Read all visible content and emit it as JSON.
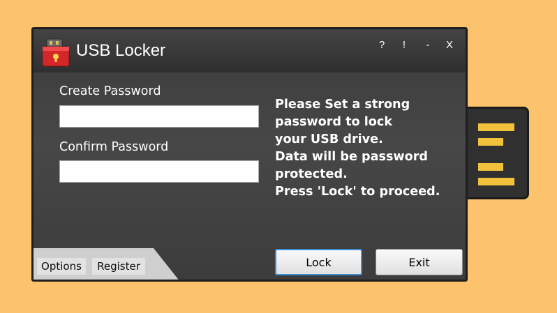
{
  "window": {
    "title": "USB Locker",
    "controls": {
      "help": "?",
      "info": "!",
      "minimize": "-",
      "close": "X"
    }
  },
  "form": {
    "create_password_label": "Create Password",
    "create_password_value": "",
    "confirm_password_label": "Confirm Password",
    "confirm_password_value": ""
  },
  "info_text": "Please Set a strong\npassword to lock\nyour USB drive.\nData will be password\nprotected.\nPress 'Lock' to proceed.",
  "buttons": {
    "lock": "Lock",
    "exit": "Exit"
  },
  "tabs": {
    "options": "Options",
    "register": "Register"
  },
  "colors": {
    "background": "#fdc26c",
    "window": "#3c3c3c",
    "usb_pins": "#f2c13c",
    "lock_button_border": "#3d8fd6",
    "app_icon": "#d4272a"
  },
  "icons": {
    "app": "usb-lock-icon"
  }
}
